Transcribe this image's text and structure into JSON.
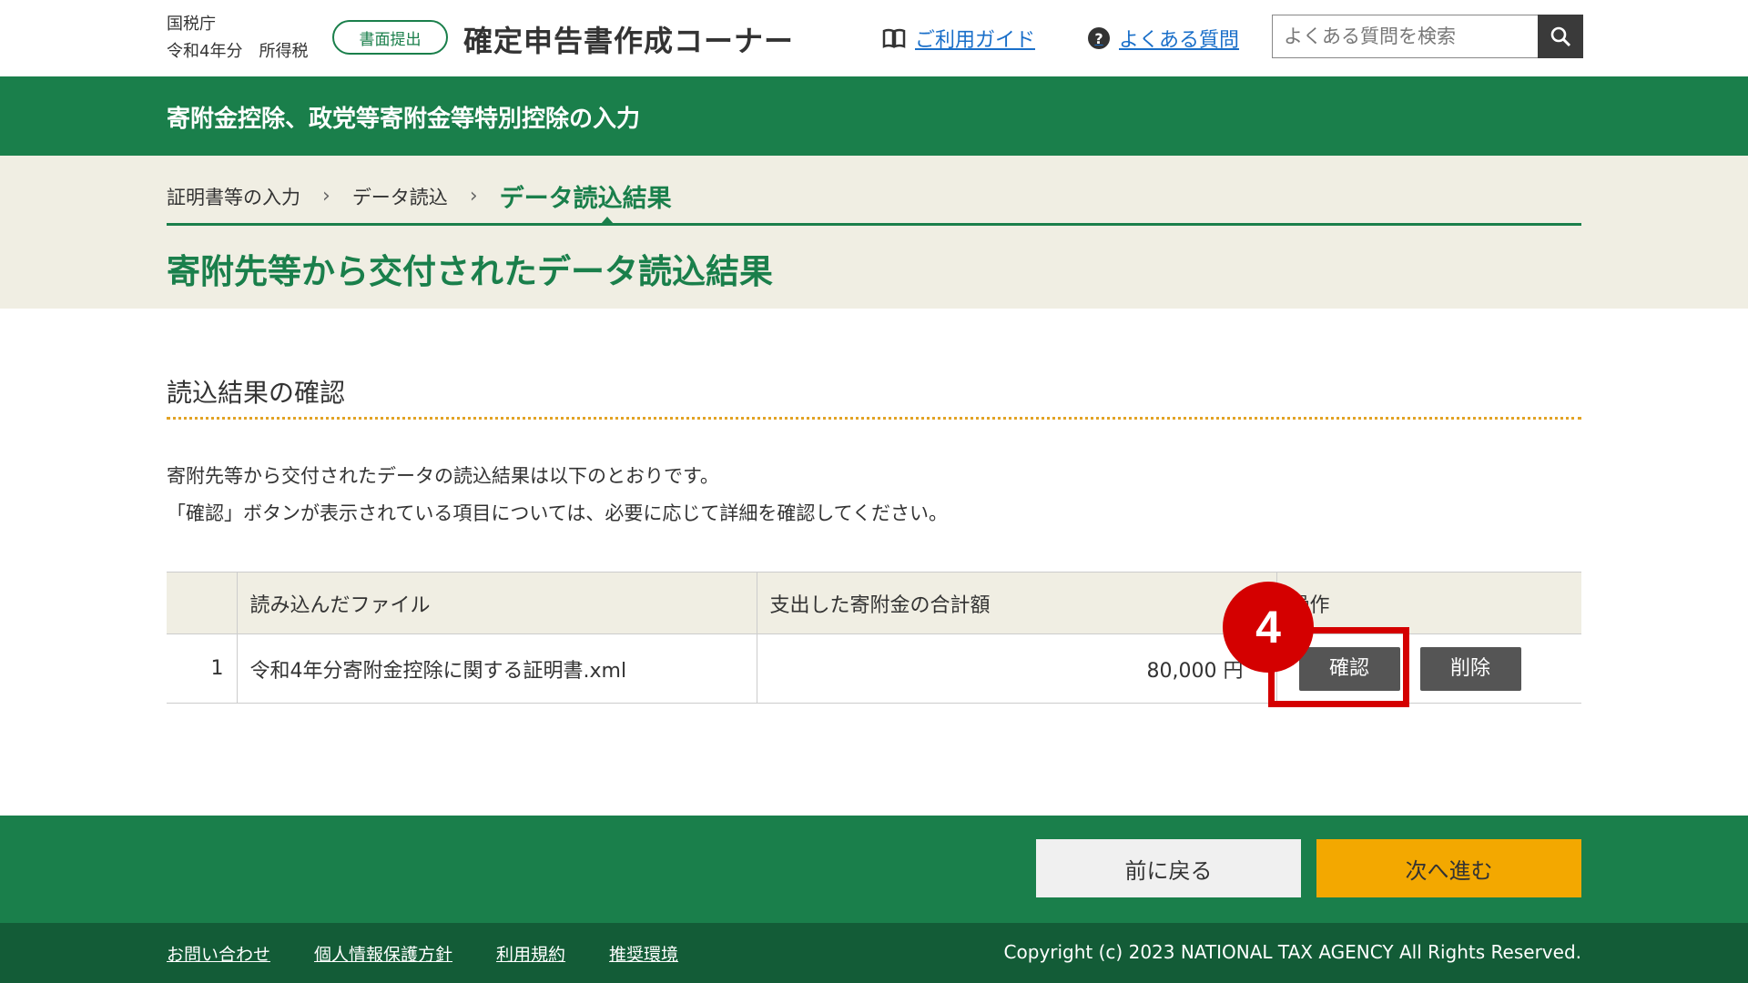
{
  "header": {
    "agency": "国税庁",
    "year_tax": "令和4年分　所得税",
    "badge": "書面提出",
    "site_title": "確定申告書作成コーナー",
    "guide_link": "ご利用ガイド",
    "faq_link": "よくある質問",
    "search_placeholder": "よくある質問を検索",
    "icons": {
      "guide": "book-icon",
      "faq": "question-icon",
      "search": "search-icon"
    }
  },
  "title_bar": "寄附金控除、政党等寄附金等特別控除の入力",
  "breadcrumb": {
    "steps": [
      "証明書等の入力",
      "データ読込",
      "データ読込結果"
    ],
    "current_index": 2
  },
  "page_title": "寄附先等から交付されたデータ読込結果",
  "section": {
    "title": "読込結果の確認",
    "desc_line1": "寄附先等から交付されたデータの読込結果は以下のとおりです。",
    "desc_line2": "「確認」ボタンが表示されている項目については、必要に応じて詳細を確認してください。"
  },
  "table": {
    "headers": [
      "",
      "読み込んだファイル",
      "支出した寄附金の合計額",
      "操作"
    ],
    "rows": [
      {
        "no": "1",
        "file": "令和4年分寄附金控除に関する証明書.xml",
        "amount": "80,000 円",
        "confirm": "確認",
        "delete": "削除"
      }
    ]
  },
  "annotation": {
    "step_number": "4",
    "color": "#d40000"
  },
  "nav": {
    "back": "前に戻る",
    "next": "次へ進む"
  },
  "footer": {
    "links": [
      "お問い合わせ",
      "個人情報保護方針",
      "利用規約",
      "推奨環境"
    ],
    "copyright": "Copyright (c) 2023 NATIONAL TAX AGENCY All Rights Reserved."
  },
  "colors": {
    "primary_green": "#1a7f4b",
    "dark_green": "#135c37",
    "beige": "#f0eee3",
    "accent_yellow": "#f3a800",
    "link_blue": "#1a6fc9"
  }
}
